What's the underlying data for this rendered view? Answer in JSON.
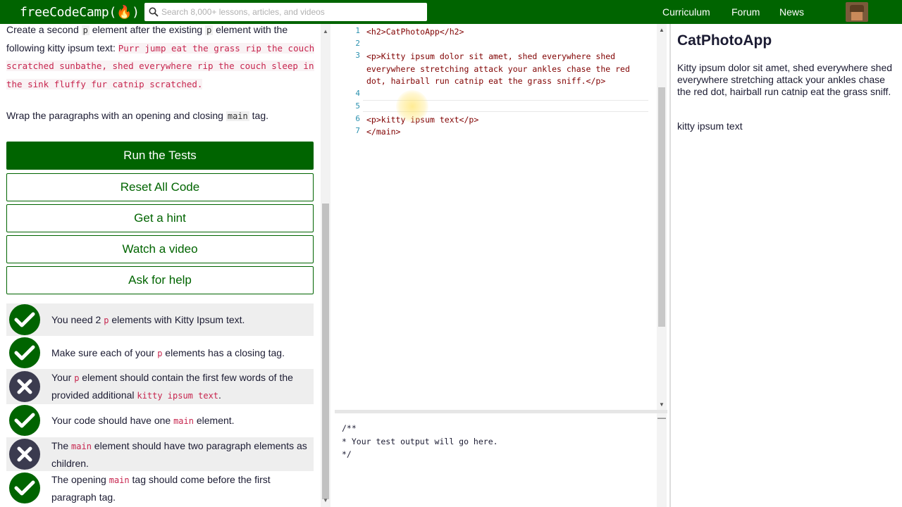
{
  "navbar": {
    "logo": "freeCodeCamp(🔥)",
    "search_placeholder": "Search 8,000+ lessons, articles, and videos",
    "links": [
      "Curriculum",
      "Forum",
      "News"
    ]
  },
  "description": {
    "line1_pre": "Create a second ",
    "line1_code": "p",
    "line1_mid": " element after the existing ",
    "line1_code2": "p",
    "line1_post": " element with the following kitty ipsum text: ",
    "kitty_text": "Purr jump eat the grass rip the couch scratched sunbathe, shed everywhere rip the couch sleep in the sink fluffy fur catnip scratched.",
    "wrap_pre": "Wrap the paragraphs with an opening and closing ",
    "wrap_code": "main",
    "wrap_post": " tag."
  },
  "buttons": {
    "run": "Run the Tests",
    "reset": "Reset All Code",
    "hint": "Get a hint",
    "video": "Watch a video",
    "help": "Ask for help"
  },
  "tests": [
    {
      "status": "pass",
      "pre": "You need 2 ",
      "code": "p",
      "post": " elements with Kitty Ipsum text."
    },
    {
      "status": "pass",
      "pre": "Make sure each of your ",
      "code": "p",
      "post": " elements has a closing tag."
    },
    {
      "status": "fail",
      "pre": "Your ",
      "code": "p",
      "post": " element should contain the first few words of the provided additional ",
      "code2": "kitty ipsum text",
      "post2": "."
    },
    {
      "status": "pass",
      "pre": "Your code should have one ",
      "code": "main",
      "post": " element."
    },
    {
      "status": "fail",
      "pre": "The ",
      "code": "main",
      "post": " element should have two paragraph elements as children."
    },
    {
      "status": "pass",
      "pre": "The opening ",
      "code": "main",
      "post": " tag should come before the first paragraph tag."
    }
  ],
  "editor": {
    "lines": [
      {
        "n": "1",
        "text": "<h2>CatPhotoApp</h2>"
      },
      {
        "n": "2",
        "text": ""
      },
      {
        "n": "3",
        "text": "<p>Kitty ipsum dolor sit amet, shed everywhere shed everywhere stretching attack your ankles chase the red dot, hairball run catnip eat the grass sniff.</p>"
      },
      {
        "n": "4",
        "text": ""
      },
      {
        "n": "5",
        "text": ""
      },
      {
        "n": "6",
        "text": "<p>kitty ipsum text</p>"
      },
      {
        "n": "7",
        "text": "</main>"
      }
    ]
  },
  "output": {
    "lines": [
      "/**",
      "* Your test output will go here.",
      "*/"
    ]
  },
  "preview": {
    "title": "CatPhotoApp",
    "p1": "Kitty ipsum dolor sit amet, shed everywhere shed everywhere stretching attack your ankles chase the red dot, hairball run catnip eat the grass sniff.",
    "p2": "kitty ipsum text"
  },
  "colors": {
    "brand": "#006400",
    "fail": "#3b3b4f",
    "code_pink": "#c7254e"
  }
}
